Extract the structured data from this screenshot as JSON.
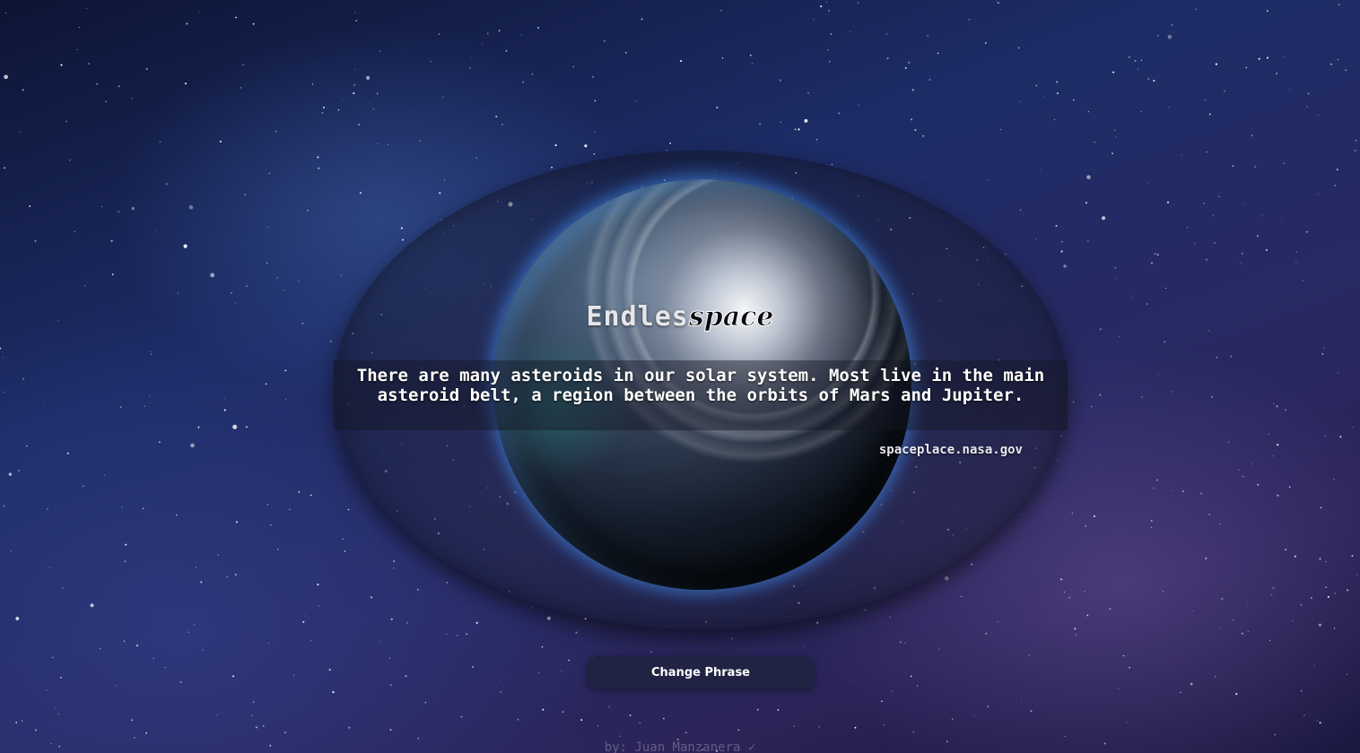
{
  "app": {
    "title_part1": "Endles",
    "title_part2": "space"
  },
  "phrase": {
    "text": "There are many asteroids in our solar system. Most live in the main asteroid belt, a region between the orbits of Mars and Jupiter.",
    "source": "spaceplace.nasa.gov"
  },
  "actions": {
    "change_phrase_label": "Change Phrase"
  },
  "footer": {
    "credit": "by: Juan Manzanera ✓"
  },
  "colors": {
    "background": "#1d2c66",
    "planet_glow": "#4696ff",
    "text": "#ffffff"
  }
}
